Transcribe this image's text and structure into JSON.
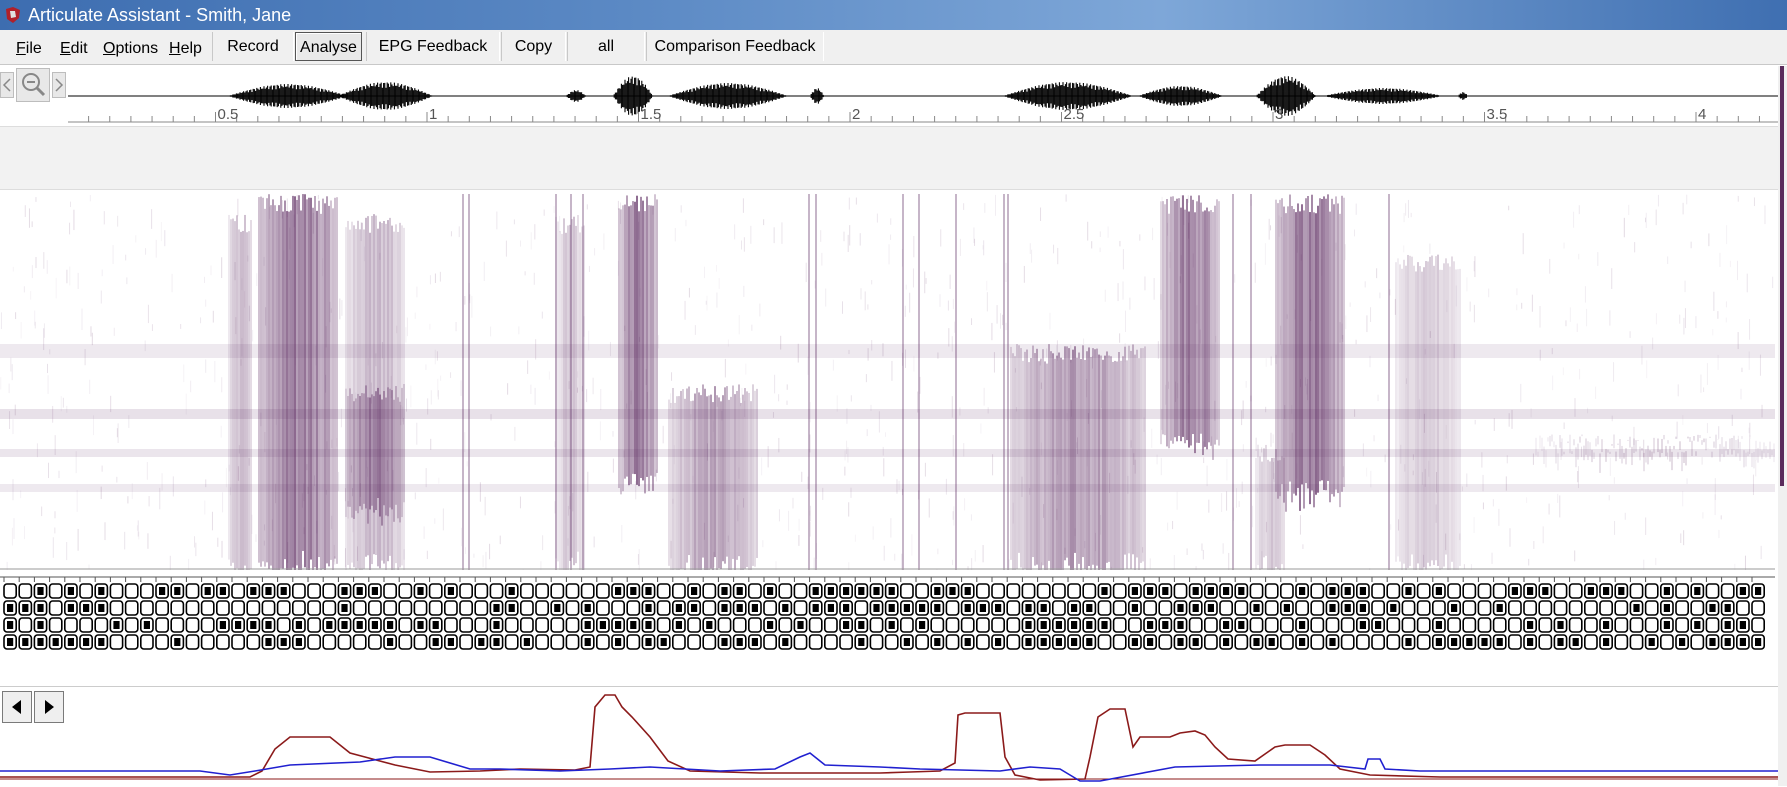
{
  "window": {
    "title": "Articulate Assistant - Smith, Jane",
    "app_icon": "app-logo-icon"
  },
  "menubar": {
    "menus": [
      {
        "label": "File",
        "mnemonic": "F",
        "rest": "ile"
      },
      {
        "label": "Edit",
        "mnemonic": "E",
        "rest": "dit"
      },
      {
        "label": "Options",
        "mnemonic": "O",
        "rest": "ptions"
      },
      {
        "label": "Help",
        "mnemonic": "H",
        "rest": "elp"
      }
    ],
    "tabs": [
      {
        "label": "Record",
        "active": false
      },
      {
        "label": "Analyse",
        "active": true
      },
      {
        "label": "EPG Feedback",
        "active": false
      },
      {
        "label": "Copy",
        "active": false
      },
      {
        "label": "all",
        "active": false
      },
      {
        "label": "Comparison Feedback",
        "active": false
      }
    ]
  },
  "timeline": {
    "ticks": [
      "0.5",
      "1",
      "1.5",
      "2",
      "2.5",
      "3",
      "3.5",
      "4"
    ],
    "icons": [
      "scroll-left-icon",
      "zoom-icon",
      "scroll-right-icon"
    ]
  },
  "spectrogram": {
    "color": "#5c2a60"
  },
  "epg": {
    "rows": 4,
    "frames": 116
  },
  "traces": {
    "icons": [
      "play-left-icon",
      "play-right-icon"
    ],
    "colors": {
      "blue": "#2020d0",
      "red": "#8b1a1a"
    }
  }
}
